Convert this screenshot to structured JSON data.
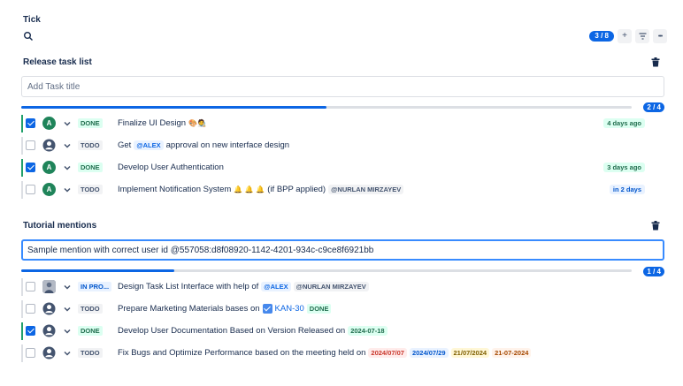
{
  "app": {
    "title": "Tick"
  },
  "toolbar": {
    "count": "3 / 8",
    "add_label": "+",
    "filter_label": "⩮",
    "more_label": "•••"
  },
  "sections": [
    {
      "title": "Release task list",
      "input_value": "",
      "input_placeholder": "Add Task title",
      "progress_label": "2 / 4",
      "progress": 0.5,
      "tasks": [
        {
          "checked": true,
          "avatar": "A",
          "status": "DONE",
          "title": "Finalize UI Design",
          "emoji": "🎨🧑‍🎨",
          "due": "4 days ago"
        },
        {
          "checked": false,
          "avatar": "person",
          "status": "TODO",
          "title_pre": "Get",
          "mention": "@ALEX",
          "title_post": "approval on new interface design"
        },
        {
          "checked": true,
          "avatar": "A",
          "status": "DONE",
          "title": "Develop User Authentication",
          "due": "3 days ago"
        },
        {
          "checked": false,
          "avatar": "A",
          "status": "TODO",
          "title": "Implement Notification System",
          "emoji": "🔔 🔔 🔔",
          "title_post": "(if BPP applied)",
          "mention": "@NURLAN MIRZAYEV",
          "due": "in 2 days"
        }
      ]
    },
    {
      "title": "Tutorial mentions",
      "input_value": "Sample mention with correct user id @557058:d8f08920-1142-4201-934c-c9ce8f6921bb",
      "input_placeholder": "Add Task title",
      "progress_label": "1 / 4",
      "progress": 0.25,
      "tasks": [
        {
          "checked": false,
          "avatar": "photo",
          "status": "IN PRO...",
          "title": "Design Task List Interface with help of",
          "mention1": "@ALEX",
          "mention2": "@NURLAN MIRZAYEV"
        },
        {
          "checked": false,
          "avatar": "person",
          "status": "TODO",
          "title": "Prepare Marketing Materials bases on",
          "issue_key": "KAN-30",
          "issue_status": "DONE"
        },
        {
          "checked": true,
          "avatar": "person",
          "status": "DONE",
          "title": "Develop User Documentation Based on Version Released on",
          "date": "2024-07-18"
        },
        {
          "checked": false,
          "avatar": "person",
          "status": "TODO",
          "title": "Fix Bugs and Optimize Performance based on the meeting held on",
          "dates": [
            "2024/07/07",
            "2024/07/29",
            "21/07/2024",
            "21-07-2024"
          ]
        }
      ]
    }
  ],
  "colors": {
    "accent": "#0c66e4",
    "done_bar": "#22a06b",
    "avatar_green": "#1f845a"
  }
}
